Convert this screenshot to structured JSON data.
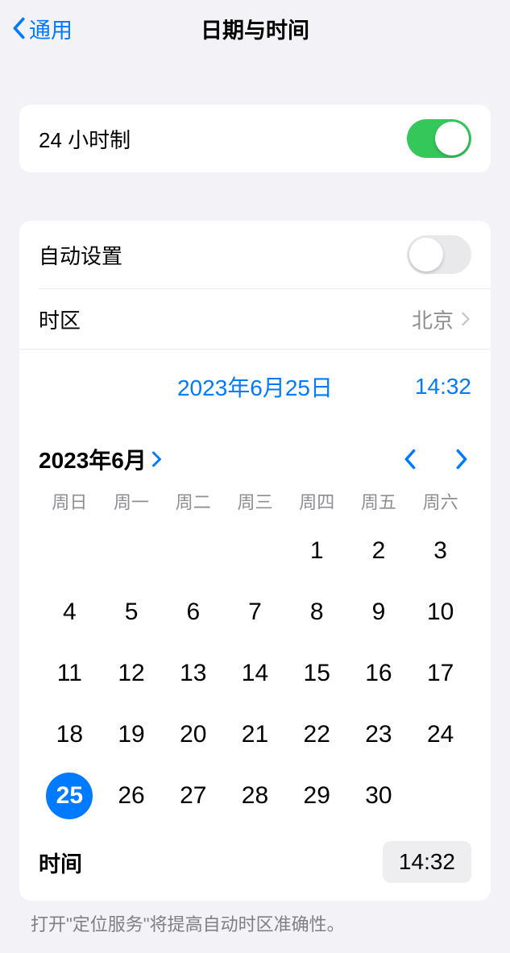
{
  "header": {
    "back_label": "通用",
    "title": "日期与时间"
  },
  "section1": {
    "time_format_label": "24 小时制",
    "time_format_on": true
  },
  "section2": {
    "auto_set_label": "自动设置",
    "auto_set_on": false,
    "timezone_label": "时区",
    "timezone_value": "北京",
    "date_preview": "2023年6月25日",
    "time_preview": "14:32",
    "month_label": "2023年6月",
    "weekdays": [
      "周日",
      "周一",
      "周二",
      "周三",
      "周四",
      "周五",
      "周六"
    ],
    "calendar": {
      "leading_blanks": 4,
      "days_in_month": 30,
      "selected_day": 25
    },
    "time_row_label": "时间",
    "time_row_value": "14:32"
  },
  "footer_note": "打开\"定位服务\"将提高自动时区准确性。"
}
